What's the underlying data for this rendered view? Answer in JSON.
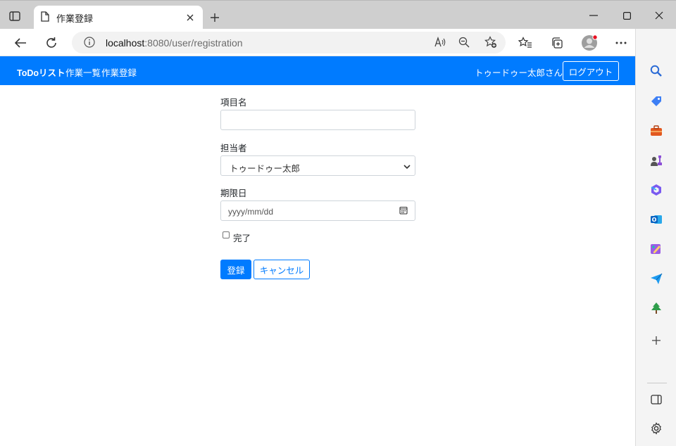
{
  "browser": {
    "tab_title": "作業登録",
    "url_host": "localhost",
    "url_rest": ":8080/user/registration"
  },
  "navbar": {
    "brand": "ToDoリスト",
    "links": [
      "作業一覧",
      "作業登録"
    ],
    "user_greeting": "トゥードゥー太郎さん",
    "logout_label": "ログアウト",
    "bg_color": "#007bff"
  },
  "form": {
    "item_name_label": "項目名",
    "item_name_value": "",
    "assignee_label": "担当者",
    "assignee_selected": "トゥードゥー太郎",
    "due_date_label": "期限日",
    "due_date_placeholder": "yyyy/mm/dd",
    "done_label": "完了",
    "done_checked": false,
    "submit_label": "登録",
    "cancel_label": "キャンセル"
  }
}
